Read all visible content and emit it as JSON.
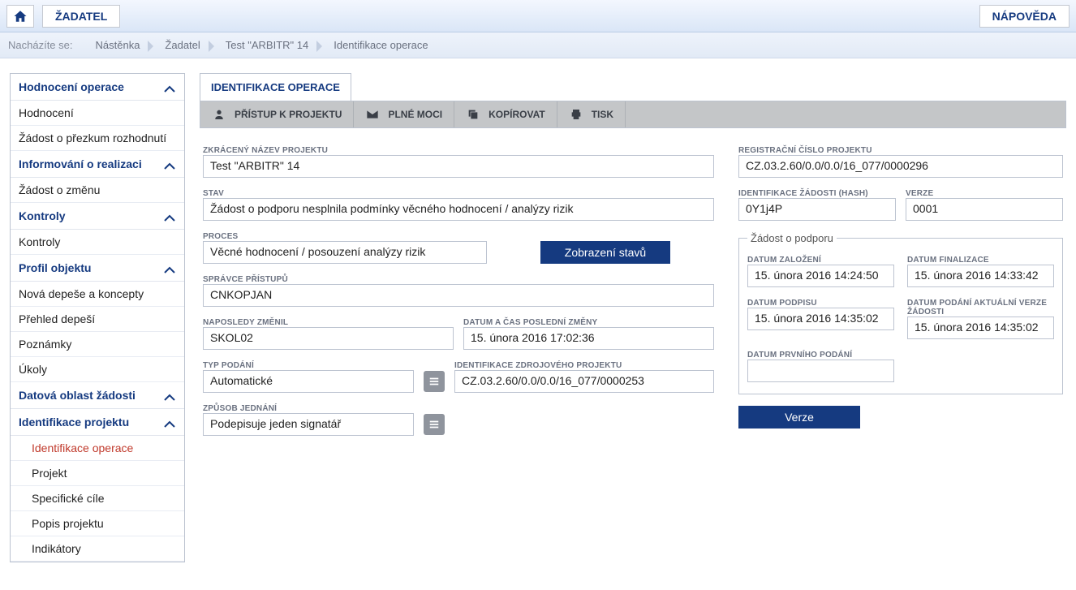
{
  "topbar": {
    "applicant_label": "ŽADATEL",
    "help_label": "NÁPOVĚDA"
  },
  "breadcrumb": {
    "label": "Nacházíte se:",
    "items": [
      "Nástěnka",
      "Žadatel",
      "Test \"ARBITR\" 14",
      "Identifikace operace"
    ]
  },
  "sidebar": {
    "s1": {
      "title": "Hodnocení operace",
      "items": [
        "Hodnocení",
        "Žádost o přezkum rozhodnutí"
      ]
    },
    "s2": {
      "title": "Informování o realizaci",
      "items": [
        "Žádost o změnu"
      ]
    },
    "s3": {
      "title": "Kontroly",
      "items": [
        "Kontroly"
      ]
    },
    "s4": {
      "title": "Profil objektu",
      "items": [
        "Nová depeše a koncepty",
        "Přehled depeší",
        "Poznámky",
        "Úkoly"
      ]
    },
    "s5": {
      "title": "Datová oblast žádosti"
    },
    "s6": {
      "title": "Identifikace projektu",
      "items": [
        "Identifikace operace",
        "Projekt",
        "Specifické cíle",
        "Popis projektu",
        "Indikátory"
      ]
    }
  },
  "main": {
    "tab_title": "IDENTIFIKACE OPERACE",
    "toolbar": {
      "access": "PŘÍSTUP K PROJEKTU",
      "powers": "PLNÉ MOCI",
      "copy": "KOPÍROVAT",
      "print": "TISK"
    },
    "labels": {
      "short_name": "ZKRÁCENÝ NÁZEV PROJEKTU",
      "state": "STAV",
      "process": "PROCES",
      "admin": "SPRÁVCE PŘÍSTUPŮ",
      "last_changed_by": "NAPOSLEDY ZMĚNIL",
      "last_change_dt": "DATUM A ČAS POSLEDNÍ ZMĚNY",
      "submit_type": "TYP PODÁNÍ",
      "src_id": "IDENTIFIKACE ZDROJOVÉHO PROJEKTU",
      "action_style": "ZPŮSOB JEDNÁNÍ",
      "reg_no": "REGISTRAČNÍ ČÍSLO PROJEKTU",
      "hash": "IDENTIFIKACE ŽÁDOSTI (HASH)",
      "version": "VERZE",
      "fieldset": "Žádost o podporu",
      "date_created": "DATUM ZALOŽENÍ",
      "date_final": "DATUM FINALIZACE",
      "date_sign": "DATUM PODPISU",
      "date_submit": "DATUM PODÁNÍ AKTUÁLNÍ VERZE ŽÁDOSTI",
      "date_first": "DATUM PRVNÍHO PODÁNÍ"
    },
    "values": {
      "short_name": "Test \"ARBITR\" 14",
      "state": "Žádost o podporu nesplnila podmínky věcného hodnocení / analýzy rizik",
      "process": "Věcné hodnocení / posouzení analýzy rizik",
      "admin": "CNKOPJAN",
      "last_changed_by": "SKOL02",
      "last_change_dt": "15. února 2016 17:02:36",
      "submit_type": "Automatické",
      "src_id": "CZ.03.2.60/0.0/0.0/16_077/0000253",
      "action_style": "Podepisuje jeden signatář",
      "reg_no": "CZ.03.2.60/0.0/0.0/16_077/0000296",
      "hash": "0Y1j4P",
      "version": "0001",
      "date_created": "15. února 2016 14:24:50",
      "date_final": "15. února 2016 14:33:42",
      "date_sign": "15. února 2016 14:35:02",
      "date_submit": "15. února 2016 14:35:02",
      "date_first": ""
    },
    "buttons": {
      "show_states": "Zobrazení stavů",
      "versions": "Verze"
    }
  }
}
